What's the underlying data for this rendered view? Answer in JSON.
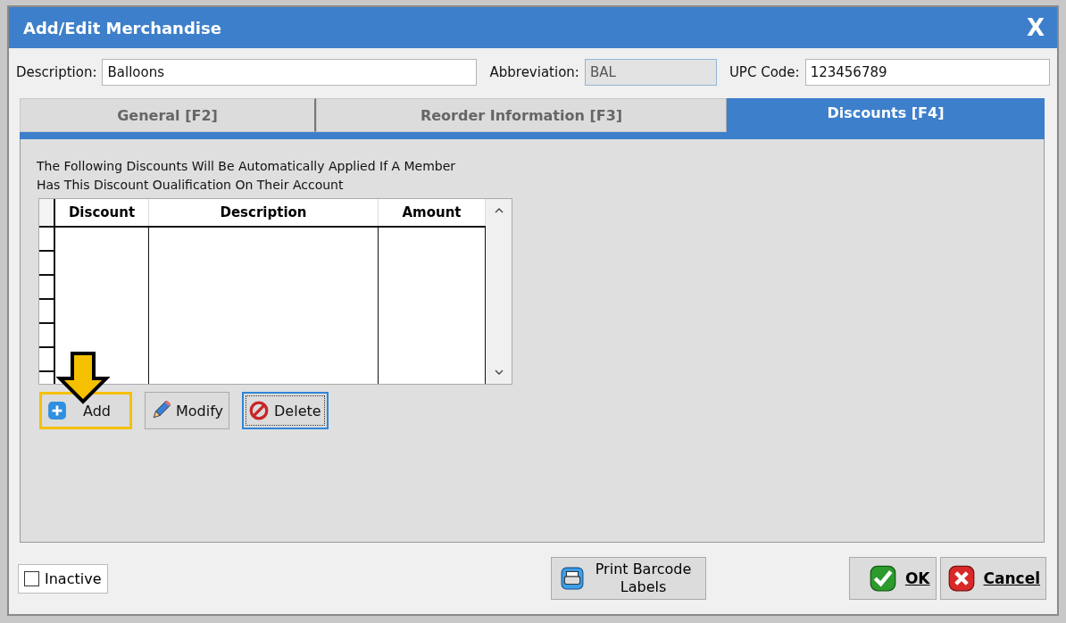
{
  "window": {
    "title": "Add/Edit Merchandise",
    "close": "X"
  },
  "fields": [
    {
      "label": "Description:",
      "value": "Balloons",
      "disabled": false
    },
    {
      "label": "Abbreviation:",
      "value": "BAL",
      "disabled": true
    },
    {
      "label": "UPC Code:",
      "value": "123456789",
      "disabled": false
    }
  ],
  "tabs": [
    {
      "label": "General [F2]",
      "selected": false
    },
    {
      "label": "Reorder Information [F3]",
      "selected": false
    },
    {
      "label": "Discounts [F4]",
      "selected": true
    }
  ],
  "intro": "The Following Discounts Will Be Automatically Applied If A Member Has This Discount Oualification On Their Account",
  "table": {
    "columns": [
      "Discount",
      "Description",
      "Amount"
    ]
  },
  "buttons": [
    {
      "kind": "add",
      "label": "Add",
      "highlighted": true,
      "focused": false
    },
    {
      "kind": "modify",
      "label": "Modify",
      "highlighted": false,
      "focused": false
    },
    {
      "kind": "delete",
      "label": "Delete",
      "highlighted": false,
      "focused": true
    }
  ],
  "inactive": {
    "label": "Inactive",
    "checked": false
  },
  "print_button": {
    "label": "Print Barcode Labels"
  },
  "footer_buttons": [
    {
      "kind": "ok",
      "label": "OK"
    },
    {
      "kind": "cancel",
      "label": "Cancel"
    }
  ]
}
